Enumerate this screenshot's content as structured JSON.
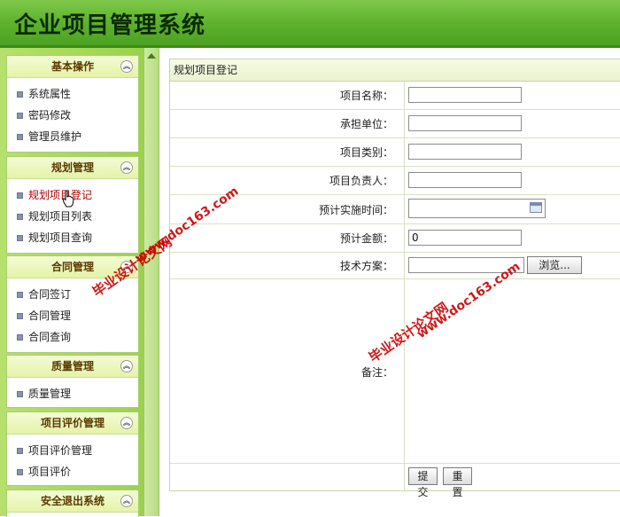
{
  "header": {
    "title": "企业项目管理系统"
  },
  "sidebar": {
    "panels": [
      {
        "title": "基本操作",
        "items": [
          "系统属性",
          "密码修改",
          "管理员维护"
        ]
      },
      {
        "title": "规划管理",
        "items": [
          "规划项目登记",
          "规划项目列表",
          "规划项目查询"
        ]
      },
      {
        "title": "合同管理",
        "items": [
          "合同签订",
          "合同管理",
          "合同查询"
        ]
      },
      {
        "title": "质量管理",
        "items": [
          "质量管理"
        ]
      },
      {
        "title": "项目评价管理",
        "items": [
          "项目评价管理",
          "项目评价"
        ]
      },
      {
        "title": "安全退出系统",
        "items": []
      }
    ]
  },
  "form": {
    "title": "规划项目登记",
    "fields": {
      "name_label": "项目名称：",
      "unit_label": "承担单位：",
      "category_label": "项目类别：",
      "leader_label": "项目负责人：",
      "time_label": "预计实施时间：",
      "amount_label": "预计金额：",
      "amount_value": "0",
      "plan_label": "技术方案：",
      "browse_label": "浏览...",
      "remark_label": "备注："
    },
    "submit_label": "提交",
    "reset_label": "重置"
  },
  "watermark": {
    "line1": "www.doc163.com",
    "line2": "毕业设计论文网",
    "line3": "www.doc163.com"
  }
}
